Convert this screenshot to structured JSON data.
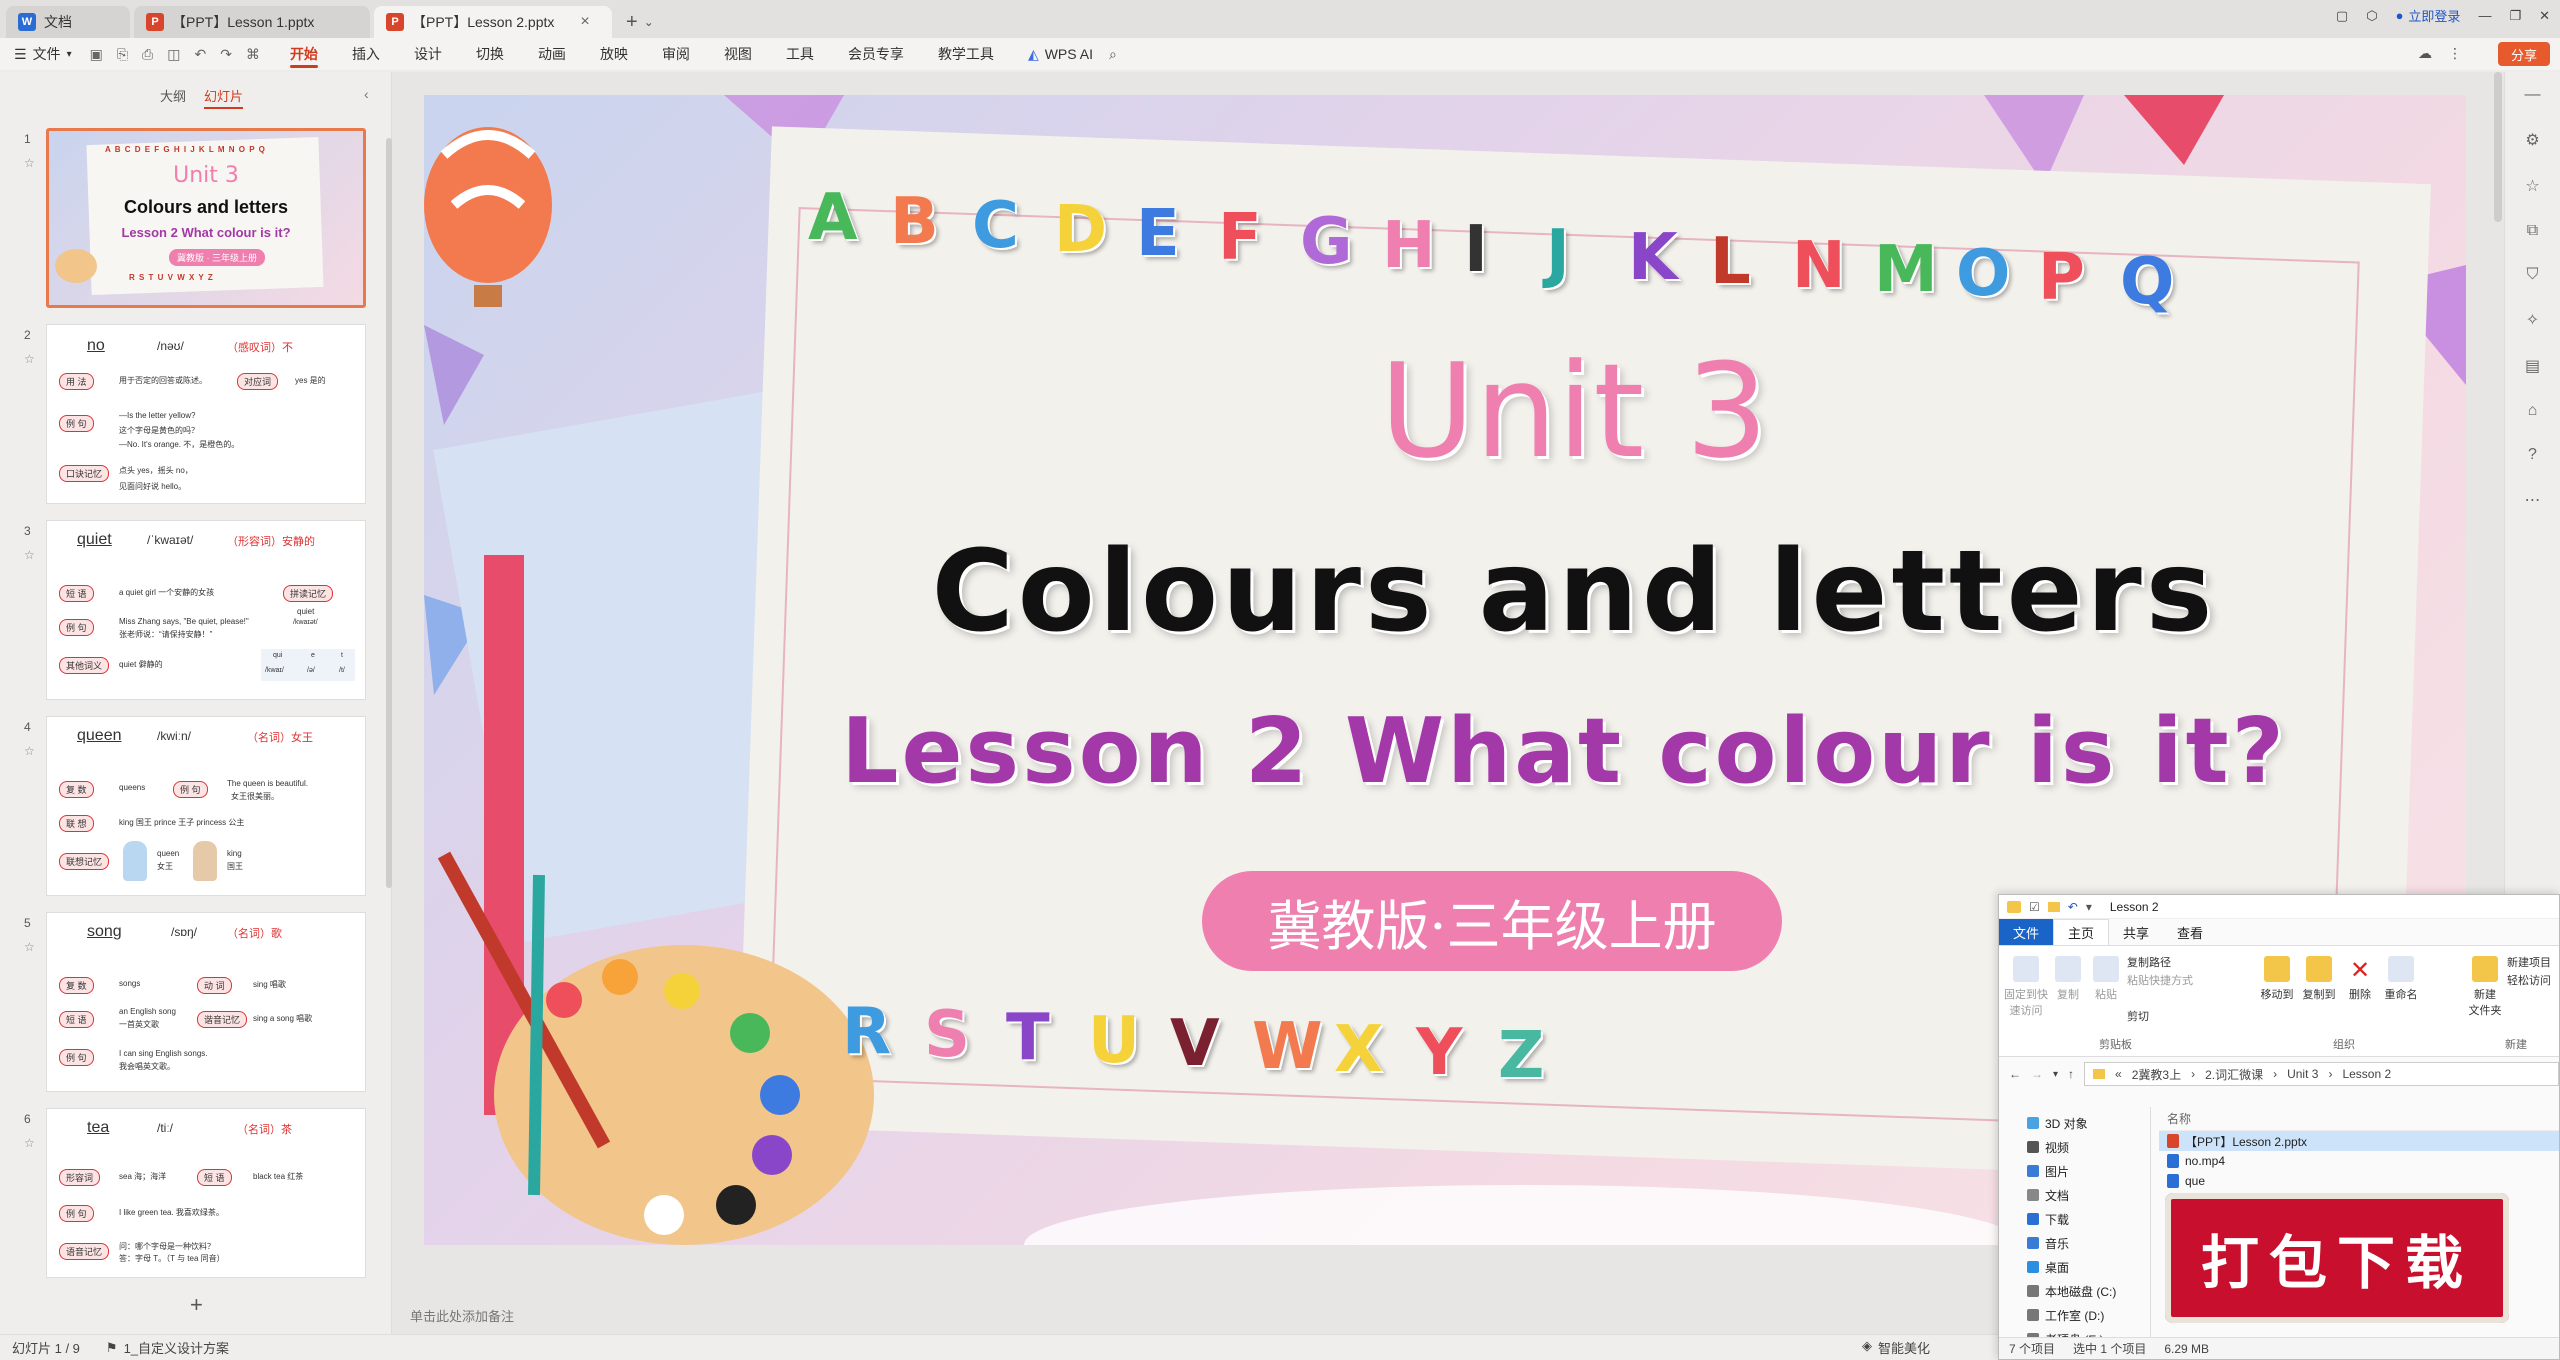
{
  "tabs": [
    {
      "label": "文档",
      "icon": "W",
      "color": "#2b6cd4"
    },
    {
      "label": "【PPT】Lesson 1.pptx",
      "icon": "P",
      "color": "#d9452b"
    },
    {
      "label": "【PPT】Lesson 2.pptx",
      "icon": "P",
      "color": "#d9452b"
    }
  ],
  "topright": {
    "login": "立即登录"
  },
  "ribbon": {
    "file_menu": "文件",
    "tabs": [
      "开始",
      "插入",
      "设计",
      "切换",
      "动画",
      "放映",
      "审阅",
      "视图",
      "工具",
      "会员专享",
      "教学工具"
    ],
    "wps_ai": "WPS AI",
    "share": "分享"
  },
  "left_panel": {
    "tab_outline": "大纲",
    "tab_slides": "幻灯片"
  },
  "thumbs": [
    {
      "num": "1",
      "alpha": "A B C D E F G H I J K L M N O P Q",
      "unit": "Unit 3",
      "title": "Colours and letters",
      "lesson": "Lesson 2 What colour is it?",
      "badge": "冀教版 · 三年级上册",
      "alpha2": "R S T U V W X Y Z"
    },
    {
      "num": "2",
      "word": "no",
      "phon": "/nəʊ/",
      "pos": "（感叹词）不",
      "rows": [
        "用 法",
        "例 句",
        "口诀记忆"
      ],
      "lines": [
        "用于否定的回答或陈述。",
        "—Is the letter yellow?",
        "这个字母是黄色的吗？",
        "—No. It's orange. 不，是橙色的。",
        "点头 yes，摇头 no，",
        "见面问好说 hello。"
      ],
      "extra": [
        "对应词",
        "yes 是的"
      ]
    },
    {
      "num": "3",
      "word": "quiet",
      "phon": "/ˈkwaɪət/",
      "pos": "（形容词）安静的",
      "rows": [
        "短 语",
        "例 句",
        "其他词义"
      ],
      "lines": [
        "a quiet girl 一个安静的女孩",
        "Miss Zhang says, \"Be quiet, please!\"",
        "张老师说：“请保持安静！”",
        "quiet 僻静的"
      ],
      "extra": [
        "拼读记忆",
        "quiet",
        "/kwaɪət/",
        "qui",
        "e",
        "t",
        "/kwaɪ/",
        "/ə/",
        "/t/"
      ]
    },
    {
      "num": "4",
      "word": "queen",
      "phon": "/kwiːn/",
      "pos": "（名词）女王",
      "rows": [
        "复 数",
        "联 想",
        "联想记忆"
      ],
      "lines": [
        "queens",
        "The queen is beautiful.",
        "女王很美丽。",
        "king 国王 prince 王子 princess 公主",
        "queen",
        "女王",
        "king",
        "国王"
      ],
      "extra": [
        "例 句"
      ]
    },
    {
      "num": "5",
      "word": "song",
      "phon": "/sɒŋ/",
      "pos": "（名词）歌",
      "rows": [
        "复 数",
        "短 语",
        "例 句"
      ],
      "lines": [
        "songs",
        "sing 唱歌",
        "an English song",
        "一首英文歌",
        "sing a song 唱歌",
        "I can sing English songs.",
        "我会唱英文歌。"
      ],
      "extra": [
        "动 词",
        "谐音记忆"
      ]
    },
    {
      "num": "6",
      "word": "tea",
      "phon": "/tiː/",
      "pos": "（名词）茶",
      "rows": [
        "形容词",
        "例 句",
        "语音记忆"
      ],
      "lines": [
        "sea 海；海洋",
        "black tea 红茶",
        "I like green tea. 我喜欢绿茶。",
        "问：哪个字母是一种饮料？",
        "答：字母 T。（T 与 tea 同音）"
      ],
      "extra": [
        "短 语"
      ]
    }
  ],
  "slide": {
    "letters_top": [
      "A",
      "B",
      "C",
      "D",
      "E",
      "F",
      "G",
      "H",
      "I",
      "J",
      "K",
      "L",
      "N",
      "M",
      "O",
      "P",
      "Q"
    ],
    "letters_bottom": [
      "R",
      "S",
      "T",
      "U",
      "V",
      "W",
      "X",
      "Y",
      "Z"
    ],
    "unit": "Unit 3",
    "title": "Colours and letters",
    "lesson": "Lesson 2 What colour is it?",
    "badge": "冀教版·三年级上册"
  },
  "notes_placeholder": "单击此处添加备注",
  "status": {
    "slide_count": "幻灯片 1 / 9",
    "theme": "1_自定义设计方案",
    "beautify": "智能美化"
  },
  "explorer": {
    "title": "Lesson 2",
    "tabs": [
      "文件",
      "主页",
      "共享",
      "查看"
    ],
    "ribbon_items": [
      "固定到快",
      "速访问",
      "复制",
      "粘贴",
      "复制路径",
      "粘贴快捷方式",
      "剪切",
      "剪贴板",
      "移动到",
      "复制到",
      "删除",
      "重命名",
      "组织",
      "新建",
      "文件夹",
      "新建项目",
      "轻松访问",
      "新建"
    ],
    "path": [
      "«",
      "2冀教3上",
      "2.词汇微课",
      "Unit 3",
      "Lesson 2"
    ],
    "nav": [
      {
        "label": "3D 对象",
        "color": "#4aa3e0"
      },
      {
        "label": "视频",
        "color": "#555"
      },
      {
        "label": "图片",
        "color": "#3a7bd5"
      },
      {
        "label": "文档",
        "color": "#888"
      },
      {
        "label": "下载",
        "color": "#2a6fd4"
      },
      {
        "label": "音乐",
        "color": "#3a7bd5"
      },
      {
        "label": "桌面",
        "color": "#2a8fe0"
      },
      {
        "label": "本地磁盘 (C:)",
        "color": "#777"
      },
      {
        "label": "工作室 (D:)",
        "color": "#777"
      },
      {
        "label": "老硬盘 (E:)",
        "color": "#777"
      }
    ],
    "col_name": "名称",
    "files": [
      {
        "name": "【PPT】Lesson 2.pptx",
        "type": "ppt",
        "selected": true
      },
      {
        "name": "no.mp4",
        "type": "video",
        "selected": false
      },
      {
        "name": "que",
        "type": "video",
        "selected": false
      }
    ],
    "status": [
      "7 个项目",
      "选中 1 个项目",
      "6.29 MB"
    ]
  },
  "download_banner": "打包下载"
}
